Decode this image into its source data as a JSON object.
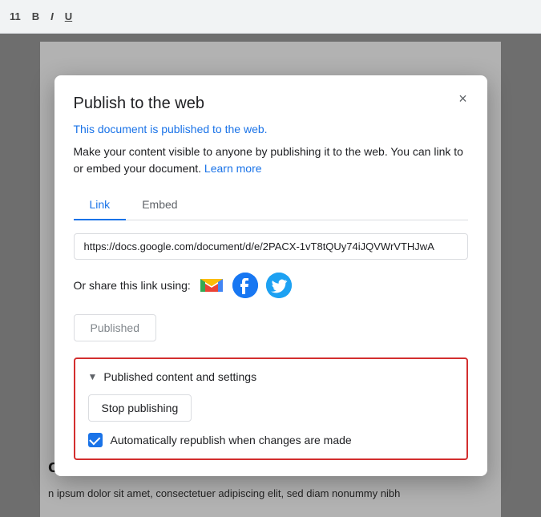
{
  "toolbar": {
    "font_size": "11",
    "bold": "B",
    "italic": "I",
    "underline": "U"
  },
  "bg_page": {
    "heading": "oduc",
    "body_text": "n ipsum dolor sit amet, consectetuer adipiscing elit, sed diam nonummy nibh"
  },
  "dialog": {
    "title": "Publish to the web",
    "close_label": "×",
    "published_status": "This document is published to the web.",
    "description": "Make your content visible to anyone by publishing it to the web. You can link to or embed your document.",
    "learn_more_text": "Learn more",
    "tabs": [
      {
        "label": "Link",
        "active": true
      },
      {
        "label": "Embed",
        "active": false
      }
    ],
    "url_value": "https://docs.google.com/document/d/e/2PACX-1vT8tQUy74iJQVWrVTHJwA",
    "url_placeholder": "",
    "share_label": "Or share this link using:",
    "share_icons": [
      {
        "name": "gmail",
        "label": "Gmail"
      },
      {
        "name": "facebook",
        "label": "Facebook"
      },
      {
        "name": "twitter",
        "label": "Twitter"
      }
    ],
    "published_button_label": "Published",
    "settings": {
      "section_label": "Published content and settings",
      "stop_button_label": "Stop publishing",
      "checkbox_label": "Automatically republish when changes are made",
      "checkbox_checked": true
    }
  }
}
